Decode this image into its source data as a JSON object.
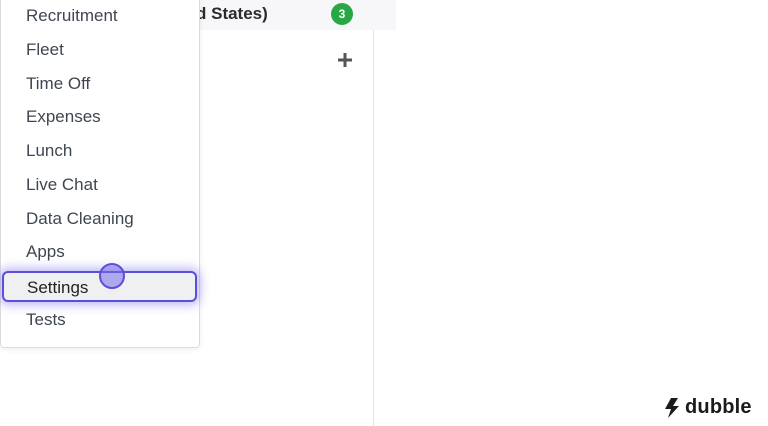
{
  "header": {
    "company_fragment": "d States)",
    "badge_count": "3",
    "badge_color": "#28a745"
  },
  "menu": {
    "items": [
      {
        "label": "Recruitment"
      },
      {
        "label": "Fleet"
      },
      {
        "label": "Time Off"
      },
      {
        "label": "Expenses"
      },
      {
        "label": "Lunch"
      },
      {
        "label": "Live Chat"
      },
      {
        "label": "Data Cleaning"
      },
      {
        "label": "Apps"
      },
      {
        "label": "Settings",
        "highlighted": true
      },
      {
        "label": "Tests"
      }
    ],
    "highlight_color": "#5a4fd6"
  },
  "icons": {
    "add": "plus-icon",
    "brand": "dubble-logo-icon"
  },
  "watermark": {
    "text": "dubble"
  }
}
